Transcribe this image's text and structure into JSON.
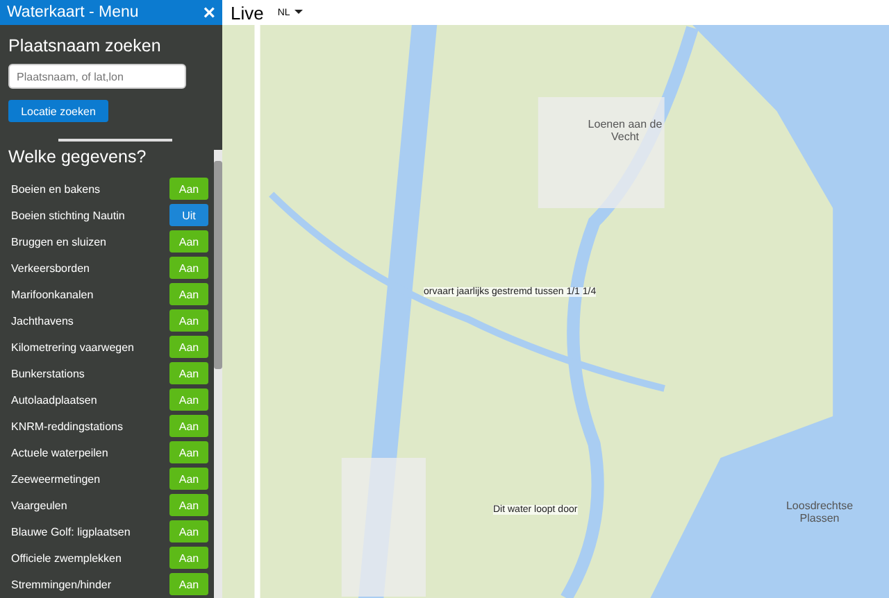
{
  "sidebar": {
    "title": "Waterkaart - Menu",
    "close": "×",
    "search_heading": "Plaatsnaam zoeken",
    "search": {
      "placeholder": "Plaatsnaam, of lat,lon"
    },
    "search_button": "Locatie zoeken",
    "layers_heading": "Welke gegevens?",
    "layers": [
      {
        "name": "Boeien en bakens",
        "on": true,
        "toggle": "Aan"
      },
      {
        "name": "Boeien stichting Nautin",
        "on": false,
        "toggle": "Uit"
      },
      {
        "name": "Bruggen en sluizen",
        "on": true,
        "toggle": "Aan"
      },
      {
        "name": "Verkeersborden",
        "on": true,
        "toggle": "Aan"
      },
      {
        "name": "Marifoonkanalen",
        "on": true,
        "toggle": "Aan"
      },
      {
        "name": "Jachthavens",
        "on": true,
        "toggle": "Aan"
      },
      {
        "name": "Kilometrering vaarwegen",
        "on": true,
        "toggle": "Aan"
      },
      {
        "name": "Bunkerstations",
        "on": true,
        "toggle": "Aan"
      },
      {
        "name": "Autolaadplaatsen",
        "on": true,
        "toggle": "Aan"
      },
      {
        "name": "KNRM-reddingstations",
        "on": true,
        "toggle": "Aan"
      },
      {
        "name": "Actuele waterpeilen",
        "on": true,
        "toggle": "Aan"
      },
      {
        "name": "Zeeweermetingen",
        "on": true,
        "toggle": "Aan"
      },
      {
        "name": "Vaargeulen",
        "on": true,
        "toggle": "Aan"
      },
      {
        "name": "Blauwe Golf: ligplaatsen",
        "on": true,
        "toggle": "Aan"
      },
      {
        "name": "Officiele zwemplekken",
        "on": true,
        "toggle": "Aan"
      },
      {
        "name": "Stremmingen/hinder",
        "on": true,
        "toggle": "Aan"
      }
    ]
  },
  "topbar": {
    "title": "Live",
    "language": "NL"
  },
  "map": {
    "labels": [
      {
        "kind": "place",
        "text": "Loenen aan de Vecht"
      },
      {
        "kind": "notice",
        "text": "orvaart jaarlijks gestremd tussen 1/1 1/4"
      },
      {
        "kind": "notice",
        "text": "Dit water loopt door"
      },
      {
        "kind": "place",
        "text": "Loosdrechtse Plassen"
      }
    ]
  }
}
